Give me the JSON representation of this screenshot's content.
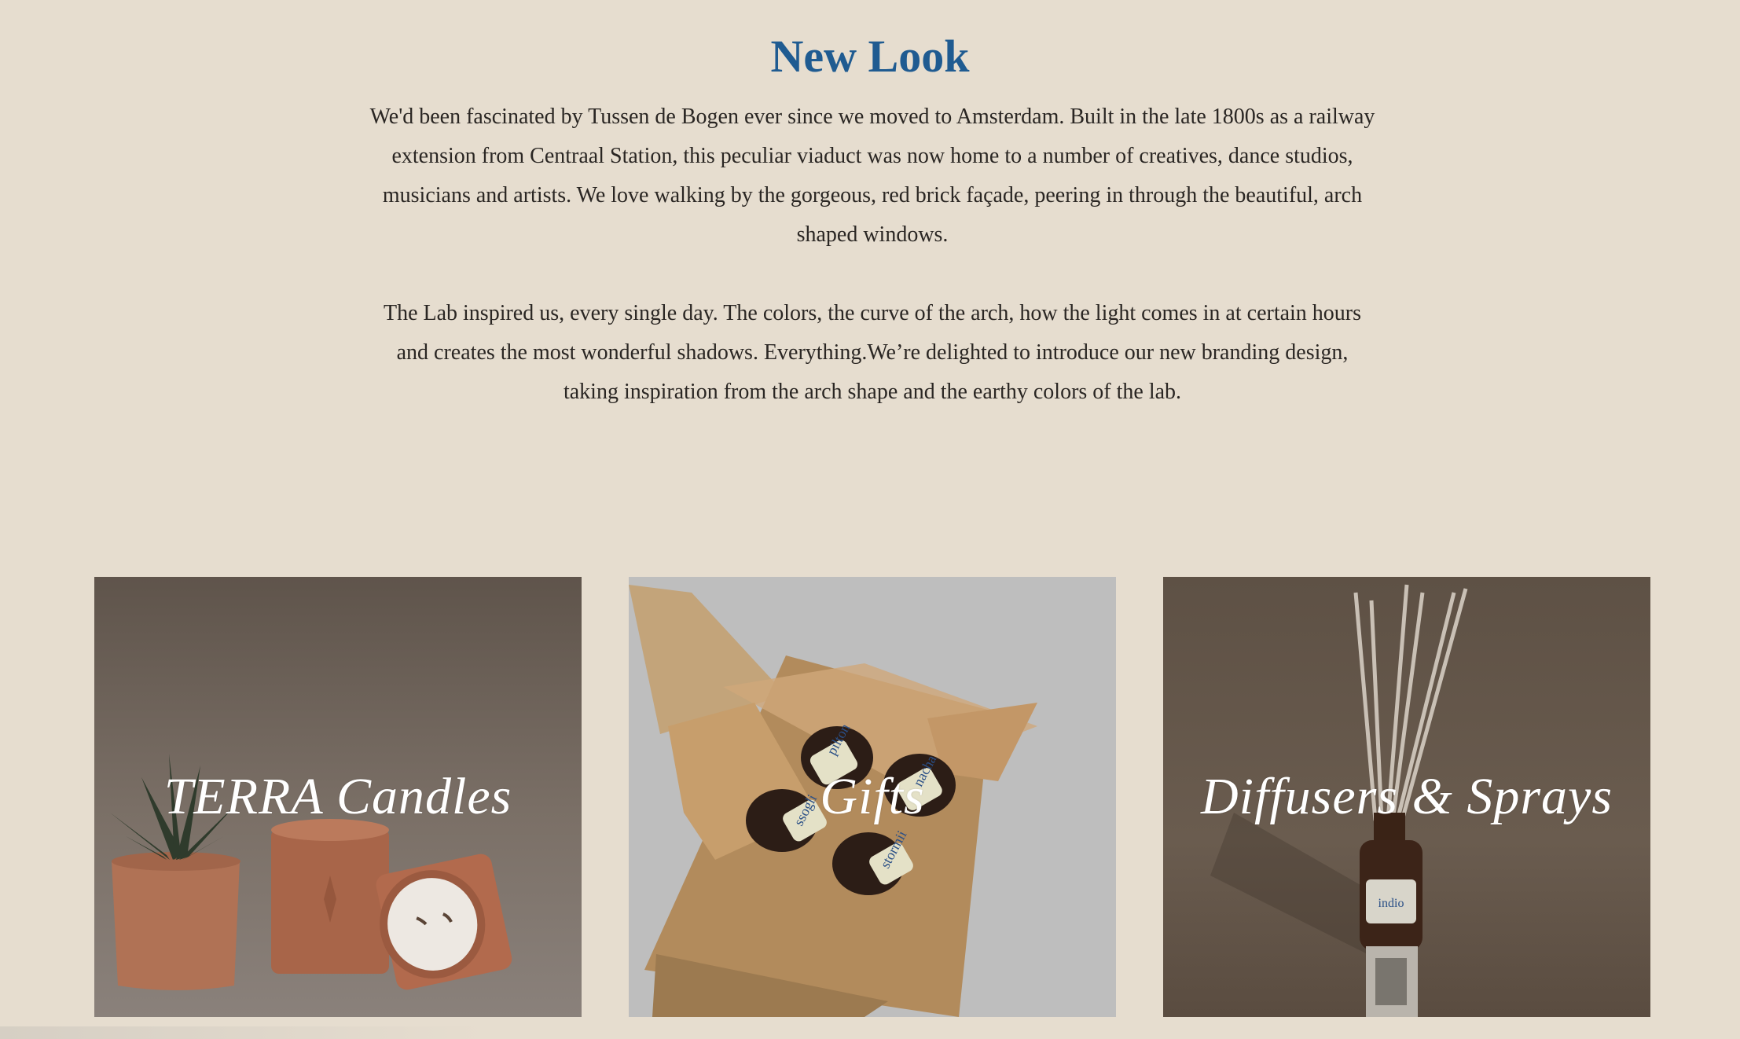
{
  "section": {
    "title": "New Look",
    "paragraphs": [
      "We'd been fascinated by Tussen de Bogen ever since we moved to Amsterdam. Built in the late 1800s as a railway extension from Centraal Station, this peculiar viaduct was now home to a number of creatives, dance studios, musicians and artists. We love walking by the gorgeous, red brick façade, peering in through the beautiful, arch shaped windows.",
      "The Lab inspired us, every single day. The colors, the curve of the arch, how the light comes in at certain hours and creates the most wonderful shadows. Everything.We’re delighted to introduce our new branding design, taking inspiration from the arch shape and the earthy colors of the lab."
    ]
  },
  "collections": [
    {
      "label": "TERRA Candles",
      "image": "candles-photo"
    },
    {
      "label": "Gifts",
      "image": "gift-box-photo",
      "jar_labels": [
        "pilton",
        "nacha",
        "ssogli",
        "stormii"
      ]
    },
    {
      "label": "Diffusers & Sprays",
      "image": "diffuser-photo",
      "bottle_label": "indio"
    }
  ],
  "colors": {
    "background": "#e6ddcf",
    "title": "#1f5b91",
    "text": "#2a2623"
  }
}
